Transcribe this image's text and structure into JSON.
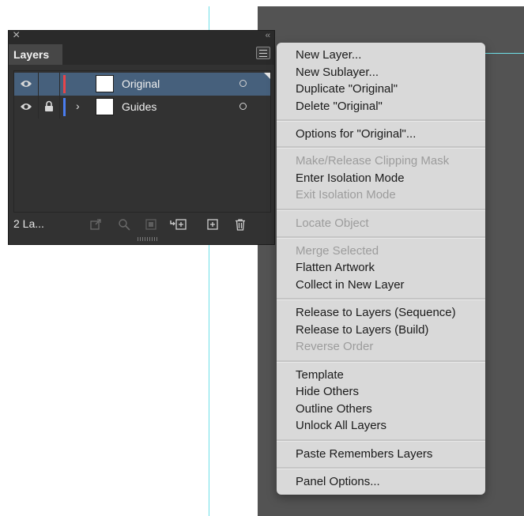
{
  "panel": {
    "title": "Layers",
    "layers": [
      {
        "name": "Original",
        "color": "#e8454a",
        "selected": true,
        "locked": false,
        "expandable": false
      },
      {
        "name": "Guides",
        "color": "#4a7df0",
        "selected": false,
        "locked": true,
        "expandable": true
      }
    ],
    "count_label": "2 La..."
  },
  "menu": {
    "groups": [
      [
        {
          "label": "New Layer...",
          "enabled": true
        },
        {
          "label": "New Sublayer...",
          "enabled": true
        },
        {
          "label": "Duplicate \"Original\"",
          "enabled": true
        },
        {
          "label": "Delete \"Original\"",
          "enabled": true
        }
      ],
      [
        {
          "label": "Options for \"Original\"...",
          "enabled": true
        }
      ],
      [
        {
          "label": "Make/Release Clipping Mask",
          "enabled": false
        },
        {
          "label": "Enter Isolation Mode",
          "enabled": true
        },
        {
          "label": "Exit Isolation Mode",
          "enabled": false
        }
      ],
      [
        {
          "label": "Locate Object",
          "enabled": false
        }
      ],
      [
        {
          "label": "Merge Selected",
          "enabled": false
        },
        {
          "label": "Flatten Artwork",
          "enabled": true
        },
        {
          "label": "Collect in New Layer",
          "enabled": true
        }
      ],
      [
        {
          "label": "Release to Layers (Sequence)",
          "enabled": true
        },
        {
          "label": "Release to Layers (Build)",
          "enabled": true
        },
        {
          "label": "Reverse Order",
          "enabled": false
        }
      ],
      [
        {
          "label": "Template",
          "enabled": true
        },
        {
          "label": "Hide Others",
          "enabled": true
        },
        {
          "label": "Outline Others",
          "enabled": true
        },
        {
          "label": "Unlock All Layers",
          "enabled": true
        }
      ],
      [
        {
          "label": "Paste Remembers Layers",
          "enabled": true
        }
      ],
      [
        {
          "label": "Panel Options...",
          "enabled": true
        }
      ]
    ]
  },
  "colors": {
    "guide": "#6fe0e8",
    "canvas_gray": "#535353",
    "selection": "#46607c"
  }
}
